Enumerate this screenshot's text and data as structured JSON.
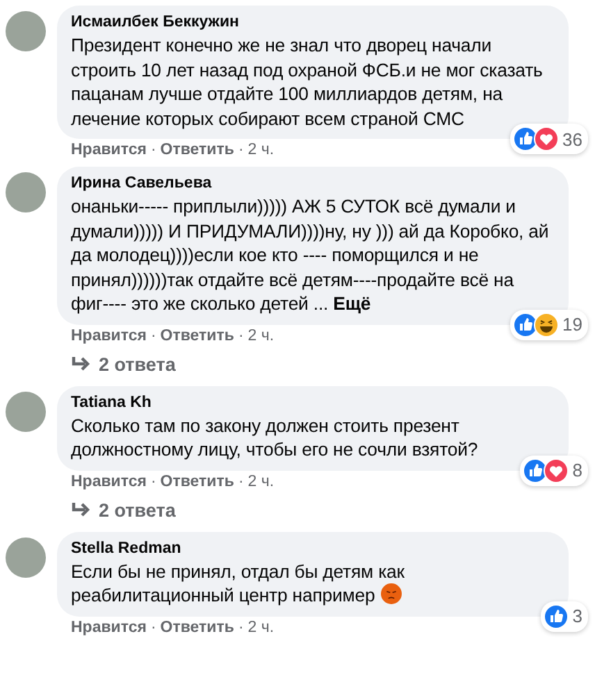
{
  "separator": "·",
  "comments": [
    {
      "author": "Исмаилбек Беккужин",
      "text": "Президент конечно же не знал что дворец начали строить 10 лет назад под охраной ФСБ.и не мог сказать пацанам лучше отдайте 100 миллиардов детям, на лечение которых собирают всем страной СМС",
      "reactions": [
        {
          "kind": "like"
        },
        {
          "kind": "love"
        }
      ],
      "reaction_count": "36",
      "actions": [
        "Нравится",
        "Ответить"
      ],
      "time": "2 ч."
    },
    {
      "author": "Ирина Савельева",
      "text": "онаньки----- приплыли))))) АЖ 5 СУТОК всё думали и думали))))) И ПРИДУМАЛИ))))ну, ну ))) ай да Коробко, ай да молодец))))если кое кто ---- поморщился и не принял))))))так отдайте всё детям----продайте всё на фиг---- это же сколько детей ...",
      "more": "Ещё",
      "reactions": [
        {
          "kind": "like"
        },
        {
          "kind": "haha"
        }
      ],
      "reaction_count": "19",
      "actions": [
        "Нравится",
        "Ответить"
      ],
      "time": "2 ч.",
      "replies": "2 ответа"
    },
    {
      "author": "Tatiana Kh",
      "text": "Сколько там по закону должен стоить презент должностному лицу, чтобы его не сочли взятой?",
      "reactions": [
        {
          "kind": "like"
        },
        {
          "kind": "love"
        }
      ],
      "reaction_count": "8",
      "actions": [
        "Нравится",
        "Ответить"
      ],
      "time": "2 ч.",
      "replies": "2 ответа"
    },
    {
      "author": "Stella Redman",
      "text": "Если бы не принял, отдал бы детям как реабилитационный центр например",
      "emoji": {
        "kind": "angry"
      },
      "reactions": [
        {
          "kind": "like"
        }
      ],
      "reaction_count": "3",
      "actions": [
        "Нравится",
        "Ответить"
      ],
      "time": "2 ч."
    }
  ]
}
